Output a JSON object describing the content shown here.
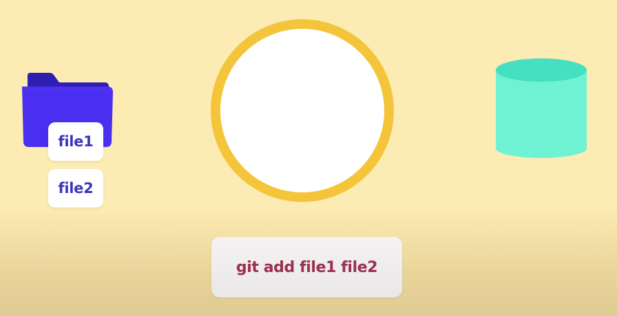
{
  "files": [
    {
      "label": "file1"
    },
    {
      "label": "file2"
    }
  ],
  "command": {
    "text": "git add file1 file2"
  },
  "colors": {
    "background": "#fcebb3",
    "folder": "#4a2ff0",
    "folder_tab": "#2f1fb0",
    "file_text": "#3b36b8",
    "staging_ring": "#f4c53a",
    "repository_body": "#6ff2d4",
    "repository_top": "#45e0c2",
    "command_text": "#9b2f4e"
  },
  "icons": {
    "working_directory": "folder-icon",
    "staging_area": "circle-icon",
    "repository": "database-cylinder-icon"
  }
}
